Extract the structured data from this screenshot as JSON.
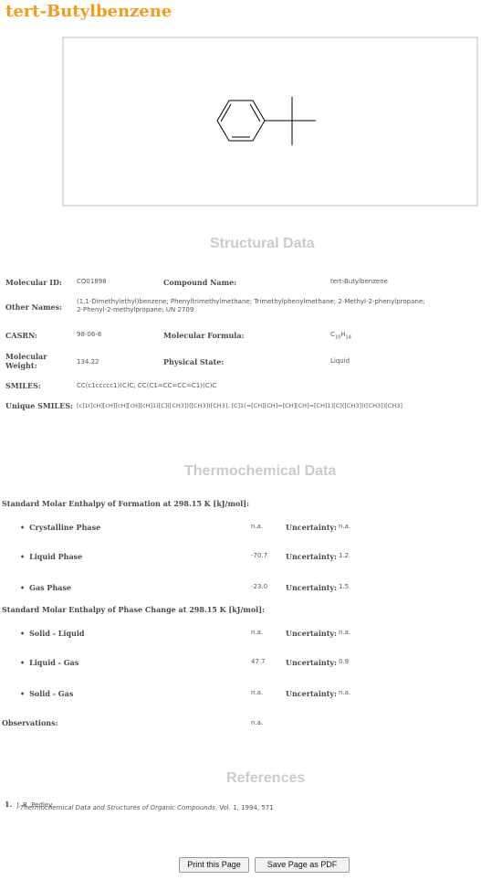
{
  "compound": {
    "title": "tert-Butylbenzene"
  },
  "structural": {
    "section_title": "Structural Data",
    "molecular_id_label": "Molecular ID:",
    "molecular_id": "CO01898",
    "compound_name_label": "Compound Name:",
    "compound_name": "tert-Butylbenzene",
    "other_names_label": "Other Names:",
    "other_names_line1": "(1,1-Dimethylethyl)benzene; Phenyltrimethylmethane; Trimethylphenylmethane; 2-Methyl-2-phenylpropane;",
    "other_names_line2": "2-Phenyl-2-methylpropane; UN 2709",
    "casrn_label": "CASRN:",
    "casrn": "98-06-6",
    "formula_label": "Molecular Formula:",
    "formula_c": "C",
    "formula_c_sub": "10",
    "formula_h": "H",
    "formula_h_sub": "14",
    "weight_label_line1": "Molecular",
    "weight_label_line2": "Weight:",
    "weight": "134.22",
    "state_label": "Physical State:",
    "state": "Liquid",
    "smiles_label": "SMILES:",
    "smiles": "CC(c1ccccc1)(C)C, CC(C1=CC=CC=C1)(C)C",
    "unique_smiles_label": "Unique SMILES:",
    "unique_smiles": "[c]1([cH][cH][cH][cH][cH]1)[C]([CH3])([CH3])[CH3], [C]1(=[CH][CH]=[CH][CH]=[CH]1)[C]([CH3])([CH3])[CH3]"
  },
  "thermo": {
    "section_title": "Thermochemical Data",
    "formation_header": "Standard Molar Enthalpy of Formation at 298.15 K [kJ/mol]:",
    "formation_rows": [
      {
        "phase": "Crystalline Phase",
        "value": "n.a.",
        "uncertainty_label": "Uncertainty:",
        "uncertainty": "n.a."
      },
      {
        "phase": "Liquid Phase",
        "value": "-70.7",
        "uncertainty_label": "Uncertainty:",
        "uncertainty": "1.2"
      },
      {
        "phase": "Gas Phase",
        "value": "-23.0",
        "uncertainty_label": "Uncertainty:",
        "uncertainty": "1.5"
      }
    ],
    "change_header": "Standard Molar Enthalpy of Phase Change at 298.15 K [kJ/mol]:",
    "change_rows": [
      {
        "phase": "Solid - Liquid",
        "value": "n.a.",
        "uncertainty_label": "Uncertainty:",
        "uncertainty": "n.a."
      },
      {
        "phase": "Liquid - Gas",
        "value": "47.7",
        "uncertainty_label": "Uncertainty:",
        "uncertainty": "0.9"
      },
      {
        "phase": "Solid - Gas",
        "value": "n.a.",
        "uncertainty_label": "Uncertainty:",
        "uncertainty": "n.a."
      }
    ],
    "observations_label": "Observations:",
    "observations": "n.a."
  },
  "references": {
    "section_title": "References",
    "items": [
      {
        "number": "1.",
        "author": "J. B. Pedley",
        "title": "Thermochemical Data and Structures of Organic Compounds",
        "details": ", Vol. 1, 1994, 571"
      }
    ]
  },
  "buttons": {
    "print_label": "Print this Page",
    "pdf_label": "Save Page as PDF"
  }
}
